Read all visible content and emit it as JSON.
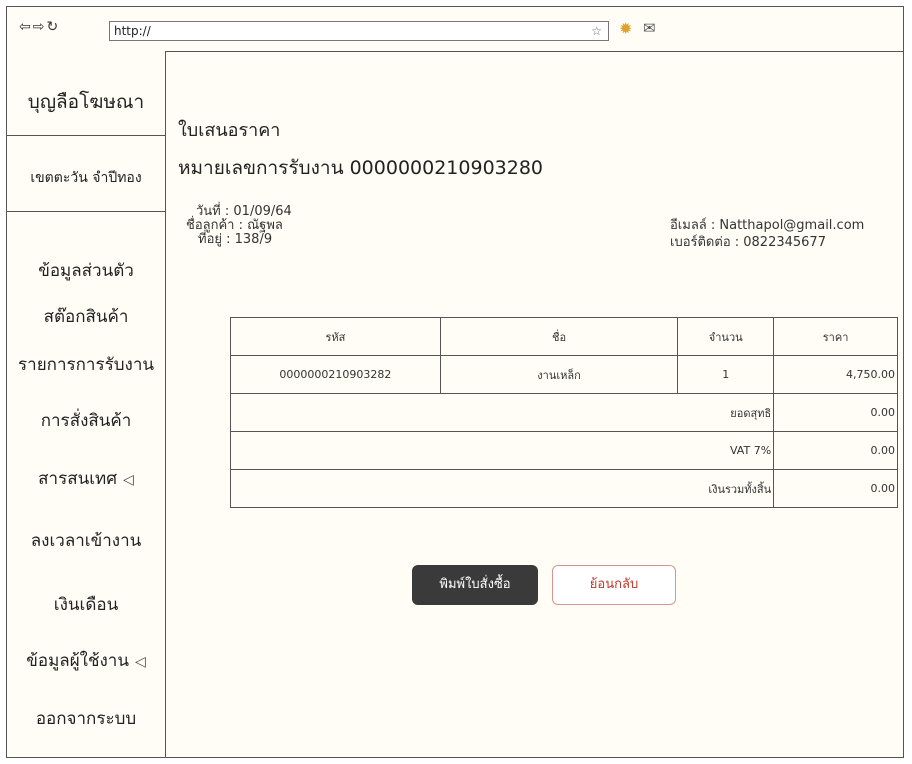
{
  "browser": {
    "url": "http://"
  },
  "sidebar": {
    "brand": "บุญลือโฆษณา",
    "user": "เขตตะวัน จำปีทอง",
    "items": [
      {
        "label": "ข้อมูลส่วนตัว"
      },
      {
        "label": "สต๊อกสินค้า"
      },
      {
        "label": "รายการการรับงาน"
      },
      {
        "label": "การสั่งสินค้า"
      },
      {
        "label": "สารสนเทศ",
        "arrow": "◁"
      },
      {
        "label": "ลงเวลาเข้างาน"
      },
      {
        "label": "เงินเดือน"
      },
      {
        "label": "ข้อมูลผู้ใช้งาน",
        "arrow": "◁"
      },
      {
        "label": "ออกจากระบบ"
      }
    ]
  },
  "doc": {
    "title": "ใบเสนอราคา",
    "job_number": "หมายเลขการรับงาน 0000000210903280",
    "date": "วันที่ : 01/09/64",
    "customer": "ชื่อลูกค้า : ณัฐพล",
    "address": "ที่อยู่ : 138/9",
    "email": "อีเมลล์ : Natthapol@gmail.com",
    "phone": "เบอร์ติดต่อ : 0822345677"
  },
  "table": {
    "headers": [
      "รหัส",
      "ชื่อ",
      "จำนวน",
      "ราคา"
    ],
    "rows": [
      {
        "code": "0000000210903282",
        "name": "งานเหล็ก",
        "qty": "1",
        "price": "4,750.00"
      }
    ],
    "summary": [
      {
        "label": "ยอดสุทธิ",
        "value": "0.00"
      },
      {
        "label": "VAT 7%",
        "value": "0.00"
      },
      {
        "label": "เงินรวมทั้งสิ้น",
        "value": "0.00"
      }
    ]
  },
  "buttons": {
    "print": "พิมพ์ใบสั่งซื้อ",
    "back": "ย้อนกลับ"
  }
}
